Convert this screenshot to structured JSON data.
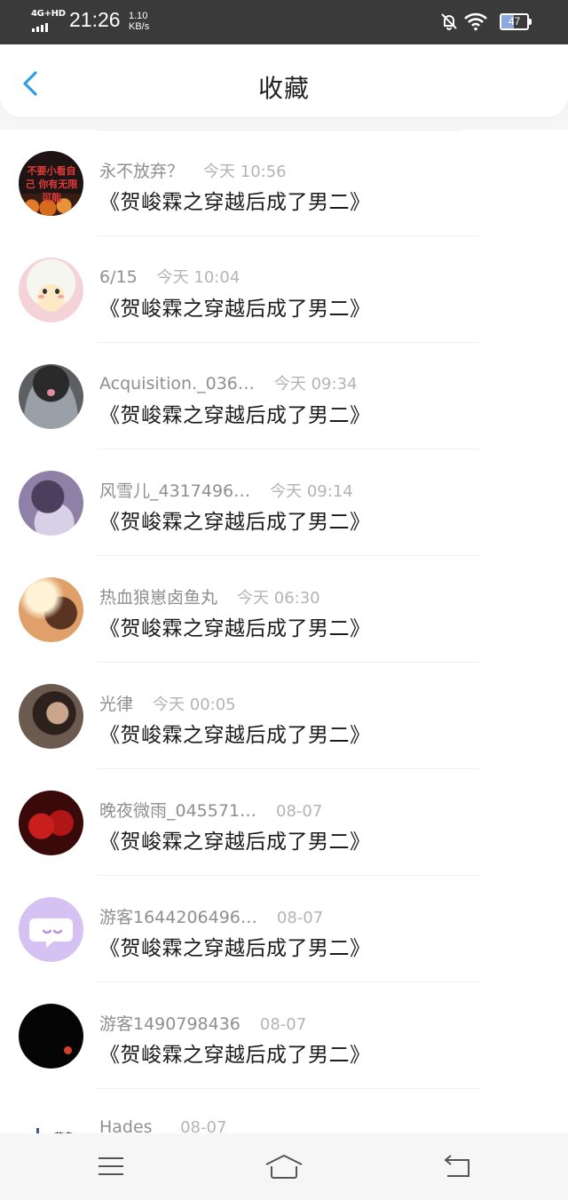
{
  "status_bar": {
    "network": "4G+HD",
    "time": "21:26",
    "speed_value": "1.10",
    "speed_unit": "KB/s",
    "battery": "47",
    "icons": [
      "signal-icon",
      "mute-bell-icon",
      "wifi-icon",
      "battery-icon"
    ]
  },
  "header": {
    "title": "收藏",
    "back_icon": "chevron-left-icon",
    "accent_color": "#2f9fe8"
  },
  "list": [
    {
      "user": "永不放弃？",
      "time": "今天 10:56",
      "book": "《贺峻霖之穿越后成了男二》",
      "avatar_text": "不要小看自己 你有无限可能"
    },
    {
      "user": "6/15",
      "time": "今天 10:04",
      "book": "《贺峻霖之穿越后成了男二》"
    },
    {
      "user": "Acquisition._036…",
      "time": "今天 09:34",
      "book": "《贺峻霖之穿越后成了男二》"
    },
    {
      "user": "风雪儿_4317496…",
      "time": "今天 09:14",
      "book": "《贺峻霖之穿越后成了男二》"
    },
    {
      "user": "热血狼崽卤鱼丸",
      "time": "今天 06:30",
      "book": "《贺峻霖之穿越后成了男二》"
    },
    {
      "user": "光律",
      "time": "今天 00:05",
      "book": "《贺峻霖之穿越后成了男二》"
    },
    {
      "user": "晚夜微雨_045571…",
      "time": "08-07",
      "book": "《贺峻霖之穿越后成了男二》"
    },
    {
      "user": "游客1644206496…",
      "time": "08-07",
      "book": "《贺峻霖之穿越后成了男二》"
    },
    {
      "user": "游客1490798436",
      "time": "08-07",
      "book": "《贺峻霖之穿越后成了男二》"
    },
    {
      "user": "Hades_",
      "time": "08-07",
      "book": "",
      "avatar_text": "蒜鸟"
    }
  ],
  "nav_bar": {
    "icons": [
      "menu-icon",
      "home-icon",
      "back-icon"
    ]
  }
}
